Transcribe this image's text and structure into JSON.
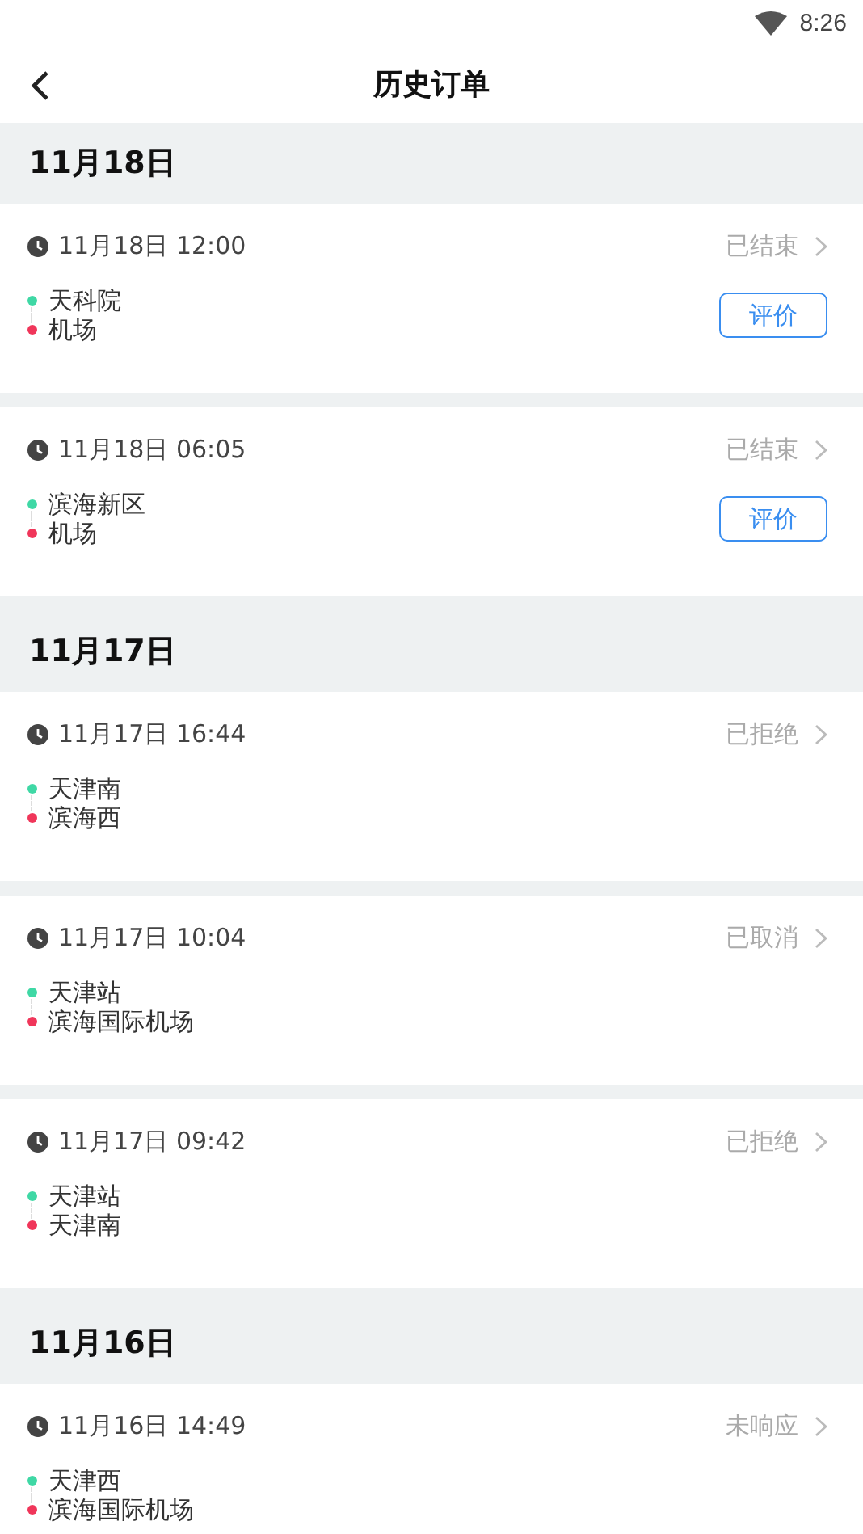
{
  "status_bar": {
    "time": "8:26"
  },
  "header": {
    "title": "历史订单"
  },
  "groups": [
    {
      "date": "11月18日",
      "orders": [
        {
          "time": "11月18日 12:00",
          "status": "已结束",
          "origin": "天科院",
          "destination": "机场",
          "action": "评价"
        },
        {
          "time": "11月18日 06:05",
          "status": "已结束",
          "origin": "滨海新区",
          "destination": "机场",
          "action": "评价"
        }
      ]
    },
    {
      "date": "11月17日",
      "orders": [
        {
          "time": "11月17日 16:44",
          "status": "已拒绝",
          "origin": "天津南",
          "destination": "滨海西"
        },
        {
          "time": "11月17日 10:04",
          "status": "已取消",
          "origin": "天津站",
          "destination": "滨海国际机场"
        },
        {
          "time": "11月17日 09:42",
          "status": "已拒绝",
          "origin": "天津站",
          "destination": "天津南"
        }
      ]
    },
    {
      "date": "11月16日",
      "orders": [
        {
          "time": "11月16日 14:49",
          "status": "未响应",
          "origin": "天津西",
          "destination": "滨海国际机场"
        }
      ]
    }
  ]
}
